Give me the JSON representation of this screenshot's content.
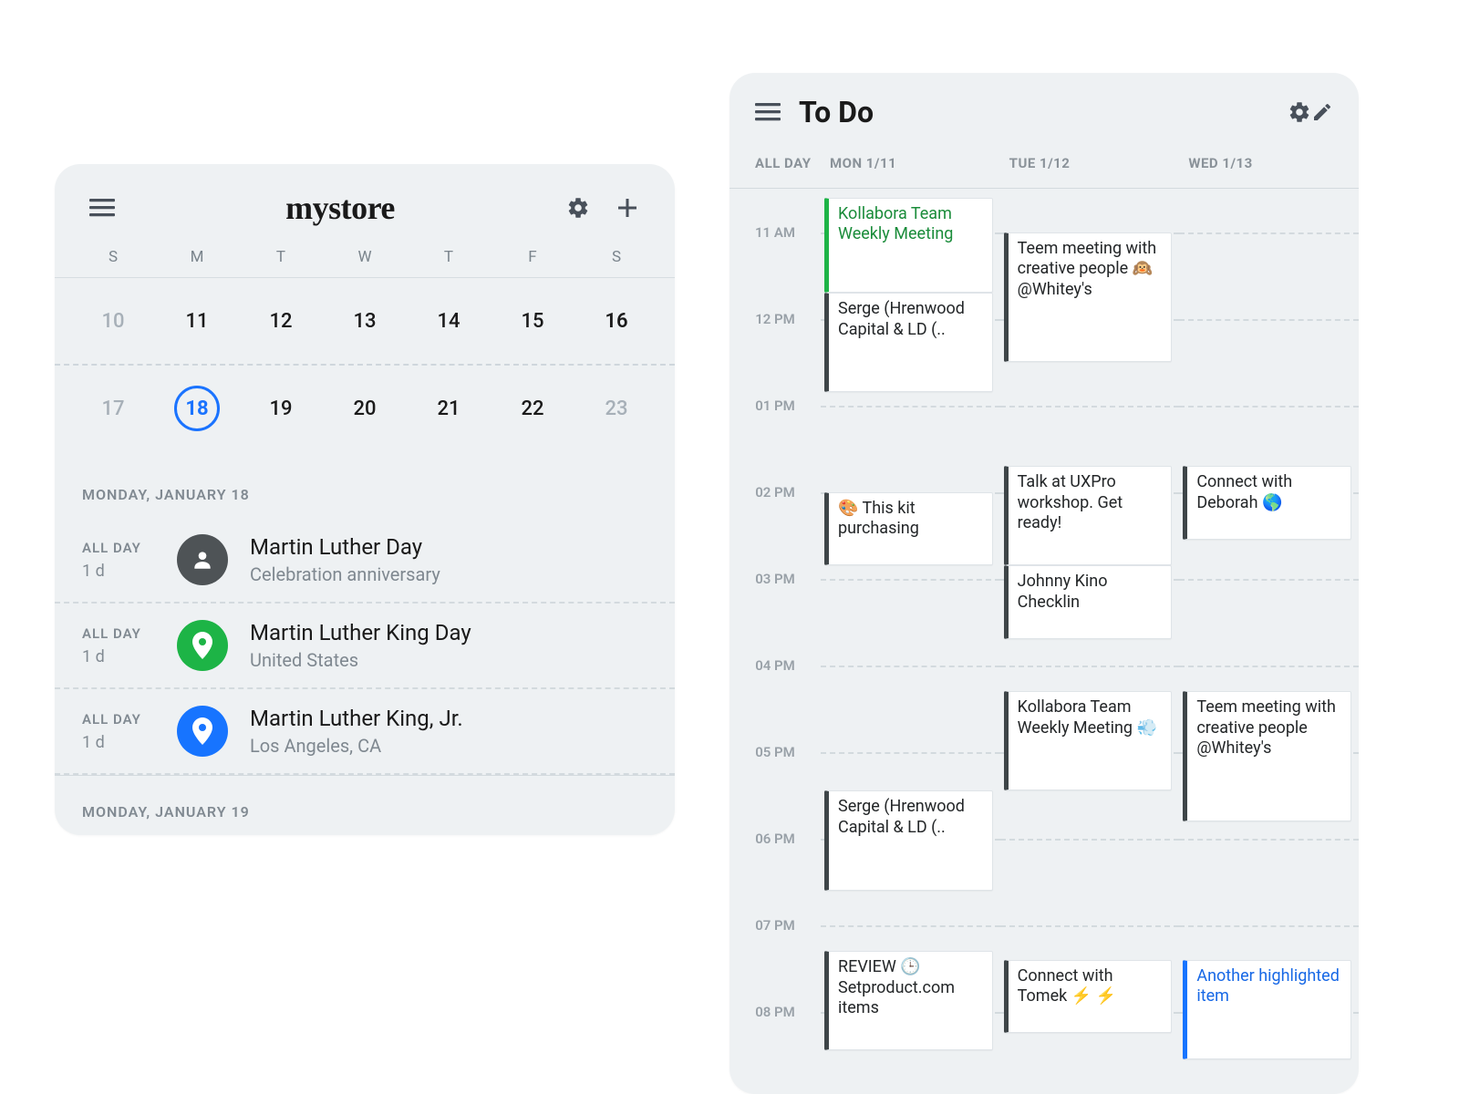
{
  "left": {
    "brand": "mystore",
    "weekdays": [
      "S",
      "M",
      "T",
      "W",
      "T",
      "F",
      "S"
    ],
    "weeks": [
      [
        {
          "n": "10",
          "muted": true
        },
        {
          "n": "11"
        },
        {
          "n": "12"
        },
        {
          "n": "13"
        },
        {
          "n": "14"
        },
        {
          "n": "15"
        },
        {
          "n": "16",
          "strong": true
        }
      ],
      [
        {
          "n": "17",
          "muted": true
        },
        {
          "n": "18",
          "selected": true
        },
        {
          "n": "19"
        },
        {
          "n": "20"
        },
        {
          "n": "21"
        },
        {
          "n": "22"
        },
        {
          "n": "23",
          "muted": true
        }
      ]
    ],
    "sections": [
      {
        "heading": "MONDAY, JANUARY 18",
        "items": [
          {
            "tag": "ALL DAY",
            "dur": "1 d",
            "icon": "person",
            "iconBg": "grey",
            "title": "Martin Luther Day",
            "sub": "Celebration anniversary"
          },
          {
            "tag": "ALL DAY",
            "dur": "1 d",
            "icon": "pin",
            "iconBg": "green",
            "title": "Martin Luther King Day",
            "sub": "United States"
          },
          {
            "tag": "ALL DAY",
            "dur": "1 d",
            "icon": "pin",
            "iconBg": "blue",
            "title": "Martin Luther King, Jr.",
            "sub": "Los Angeles, CA"
          }
        ]
      },
      {
        "heading": "MONDAY, JANUARY 19",
        "items": []
      }
    ]
  },
  "right": {
    "title": "To Do",
    "allday_label": "ALL DAY",
    "days": [
      "MON 1/11",
      "TUE 1/12",
      "WED 1/13"
    ],
    "startHour": 10.5,
    "hourHeight": 95,
    "hours": [
      {
        "label": "11 AM",
        "h": 11
      },
      {
        "label": "12 PM",
        "h": 12
      },
      {
        "label": "01 PM",
        "h": 13
      },
      {
        "label": "02 PM",
        "h": 14
      },
      {
        "label": "03 PM",
        "h": 15
      },
      {
        "label": "04 PM",
        "h": 16
      },
      {
        "label": "05 PM",
        "h": 17
      },
      {
        "label": "06 PM",
        "h": 18
      },
      {
        "label": "07 PM",
        "h": 19
      },
      {
        "label": "08 PM",
        "h": 20
      }
    ],
    "events": [
      {
        "col": 0,
        "start": 10.6,
        "end": 11.7,
        "text": "Kollabora Team Weekly Meeting",
        "variant": "green"
      },
      {
        "col": 0,
        "start": 11.7,
        "end": 12.85,
        "text": "Serge (Hrenwood Capital & LD (.."
      },
      {
        "col": 1,
        "start": 11.0,
        "end": 12.5,
        "text": "Teem meeting with creative people 🙉 @Whitey's"
      },
      {
        "col": 0,
        "start": 14.0,
        "end": 14.85,
        "text": "🎨 This kit purchasing"
      },
      {
        "col": 1,
        "start": 13.7,
        "end": 14.85,
        "text": "Talk at UXPro workshop. Get ready!"
      },
      {
        "col": 1,
        "start": 14.85,
        "end": 15.7,
        "text": "Johnny Kino Checklin"
      },
      {
        "col": 2,
        "start": 13.7,
        "end": 14.55,
        "text": "Connect with Deborah 🌎"
      },
      {
        "col": 1,
        "start": 16.3,
        "end": 17.45,
        "text": "Kollabora Team Weekly Meeting 💨"
      },
      {
        "col": 2,
        "start": 16.3,
        "end": 17.8,
        "text": "Teem meeting with creative people @Whitey's"
      },
      {
        "col": 0,
        "start": 17.45,
        "end": 18.6,
        "text": "Serge (Hrenwood Capital & LD (.."
      },
      {
        "col": 0,
        "start": 19.3,
        "end": 20.45,
        "text": "REVIEW 🕒 Setproduct.com items"
      },
      {
        "col": 1,
        "start": 19.4,
        "end": 20.25,
        "text": "Connect with Tomek ⚡ ⚡"
      },
      {
        "col": 2,
        "start": 19.4,
        "end": 20.55,
        "text": "Another highlighted item",
        "variant": "blue"
      }
    ]
  }
}
